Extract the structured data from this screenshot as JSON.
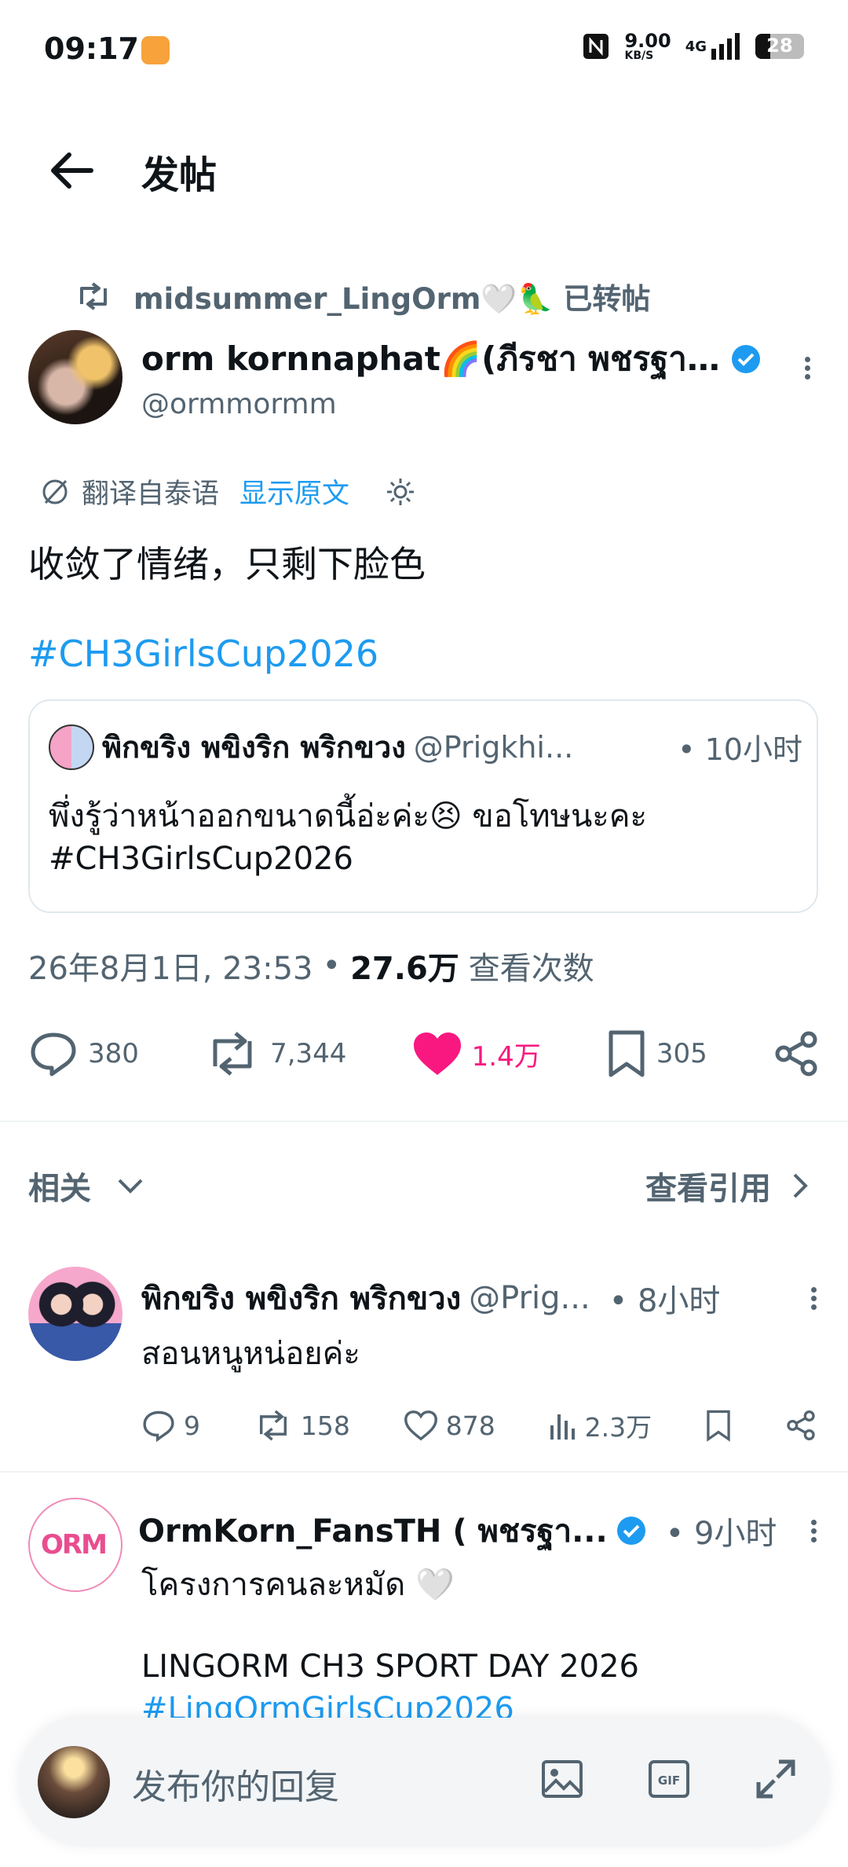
{
  "status_bar": {
    "time": "09:17",
    "speed": "9.00",
    "speed_unit": "KB/S",
    "network": "4G",
    "battery": "28"
  },
  "header": {
    "title": "发帖"
  },
  "retweet": {
    "label": "midsummer_LingOrm🤍🦜 已转帖"
  },
  "post": {
    "author_name": "orm kornnaphat🌈(ภีรชา พชรฐากู...",
    "handle": "@ormmormm",
    "translated_from": "翻译自泰语",
    "show_original": "显示原文",
    "text": "收敛了情绪，只剩下脸色",
    "hashtag": "#CH3GirlsCup2026",
    "quote": {
      "author_name": "พิกขริง พขิงริก พริกขวง",
      "handle": "@Prigkhi...",
      "time": "• 10小时",
      "text_line1": "พึ่งรู้ว่าหน้าออกขนาดนี้อ่ะค่ะ😣 ขอโทษนะคะ",
      "text_line2": "#CH3GirlsCup2026"
    },
    "timestamp": "26年8月1日, 23:53",
    "views": "27.6万",
    "views_label": "查看次数",
    "stats": {
      "replies": "380",
      "reposts": "7,344",
      "likes": "1.4万",
      "bookmarks": "305"
    },
    "like_color": "#f91880"
  },
  "related": {
    "label": "相关",
    "quotes_link": "查看引用"
  },
  "replies": [
    {
      "author_name": "พิกขริง พขิงริก พริกขวง",
      "handle": "@Prig...",
      "time": "• 8小时",
      "text": "สอนหนูหน่อยค่ะ",
      "stats": {
        "replies": "9",
        "reposts": "158",
        "likes": "878",
        "views": "2.3万"
      }
    },
    {
      "author_name": "OrmKorn_FansTH ( พชรฐา...",
      "avatar_text": "ORM",
      "time": "• 9小时",
      "line1": "โครงการคนละหมัด 🤍",
      "line2": "LINGORM CH3 SPORT DAY 2026",
      "line3": "#LingOrmGirlsCup2026"
    }
  ],
  "composer": {
    "placeholder": "发布你的回复"
  },
  "accent_color": "#1d9bf0"
}
